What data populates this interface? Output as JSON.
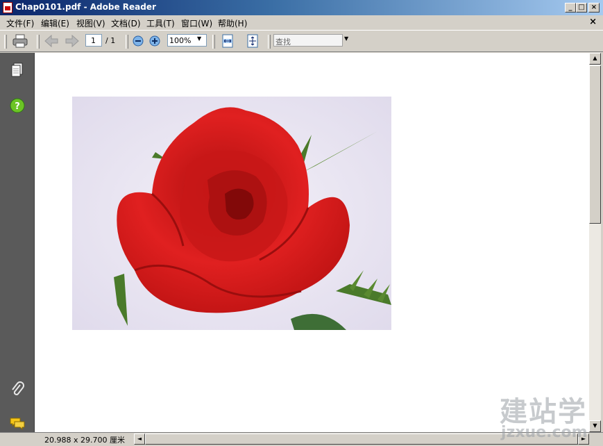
{
  "window": {
    "title": "Chap0101.pdf - Adobe Reader",
    "buttons": {
      "minimize": "_",
      "maximize": "□",
      "close": "×"
    }
  },
  "menubar": {
    "items": [
      {
        "label": "文件(F)"
      },
      {
        "label": "编辑(E)"
      },
      {
        "label": "视图(V)"
      },
      {
        "label": "文档(D)"
      },
      {
        "label": "工具(T)"
      },
      {
        "label": "窗口(W)"
      },
      {
        "label": "帮助(H)"
      }
    ],
    "close_doc": "×"
  },
  "toolbar": {
    "print_icon": "printer-icon",
    "prev_icon": "arrow-left-icon",
    "next_icon": "arrow-right-icon",
    "page_current": "1",
    "page_total": "/ 1",
    "zoom_out_icon": "zoom-out-icon",
    "zoom_in_icon": "zoom-in-icon",
    "zoom_value": "100%",
    "fit_width_icon": "fit-width-icon",
    "fit_page_icon": "fit-page-icon",
    "find_placeholder": "查找"
  },
  "navpane": {
    "icons": [
      "pages-icon",
      "help-icon",
      "attachment-icon",
      "comments-icon"
    ]
  },
  "document": {
    "image": "red-rose-photo"
  },
  "statusbar": {
    "page_size": "20.988 x 29.700 厘米"
  },
  "watermark": {
    "cn": "建站学",
    "url": "jzxue.com"
  },
  "colors": {
    "titlebar_start": "#0a246a",
    "titlebar_end": "#a6caf0",
    "navpane": "#5a5a5a",
    "rose": "#d81818",
    "leaf": "#4a7a2a"
  }
}
